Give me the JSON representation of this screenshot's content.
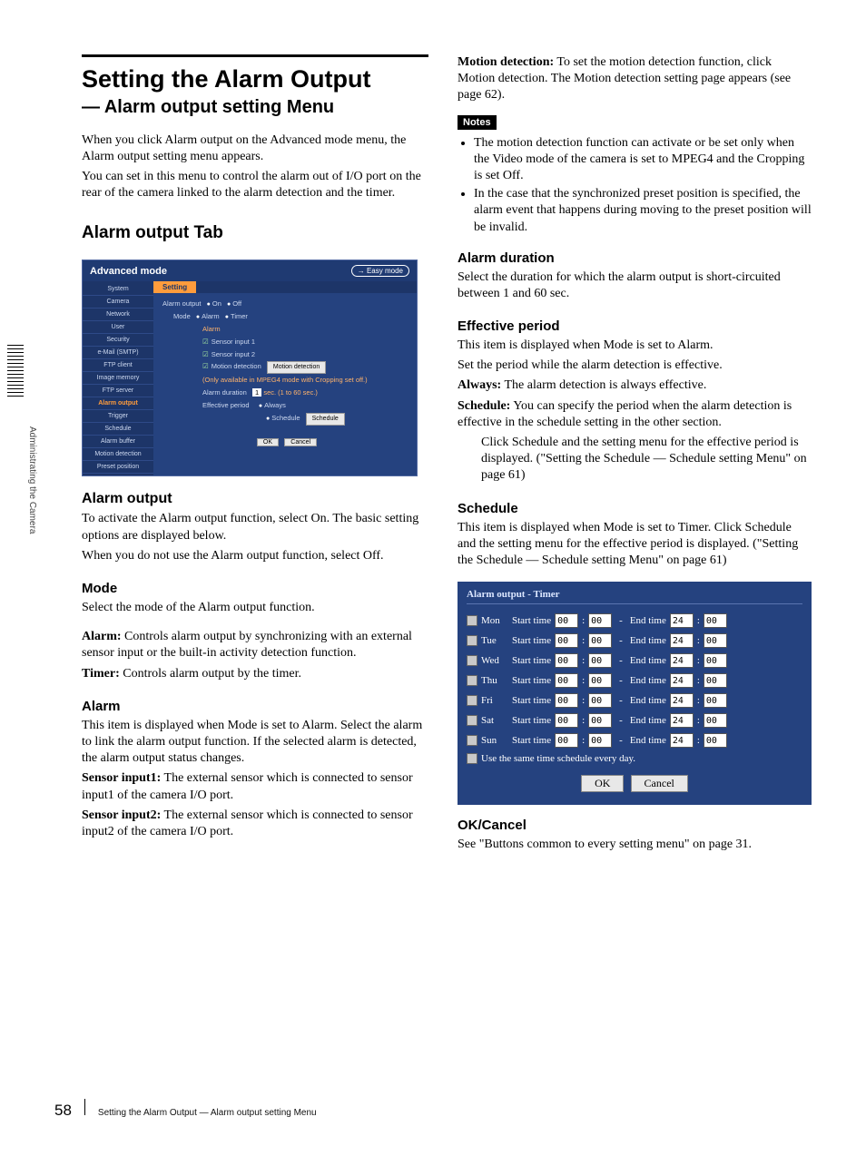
{
  "page": {
    "number": "58",
    "footer": "Setting the Alarm Output — Alarm output setting Menu",
    "side_label": "Administrating the Camera"
  },
  "heading": {
    "title": "Setting the Alarm Output",
    "subtitle": "— Alarm output setting Menu"
  },
  "intro": [
    "When you click Alarm output on the Advanced mode menu, the Alarm output setting menu appears.",
    "You can set in this menu to control the alarm out of I/O port on the rear of the camera linked to the alarm detection and the timer."
  ],
  "section_tab": "Alarm output Tab",
  "panel": {
    "mode_label": "Advanced mode",
    "easy_btn": "→ Easy mode",
    "tab": "Setting",
    "sidebar": [
      "System",
      "Camera",
      "Network",
      "User",
      "Security",
      "e-Mail (SMTP)",
      "FTP client",
      "Image memory",
      "FTP server",
      "Alarm output",
      "Trigger",
      "Schedule",
      "Alarm buffer",
      "Motion detection",
      "Preset position"
    ],
    "active_index": 9,
    "form": {
      "alarm_output_label": "Alarm output",
      "on": "On",
      "off": "Off",
      "mode_label": "Mode",
      "alarm_opt": "Alarm",
      "timer_opt": "Timer",
      "alarm_head": "Alarm",
      "sensor1": "Sensor input 1",
      "sensor2": "Sensor input 2",
      "motion": "Motion detection",
      "motion_btn": "Motion detection",
      "mpeg_note": "(Only available in MPEG4 mode with Cropping set off.)",
      "duration_label": "Alarm duration",
      "duration_val": "1",
      "duration_unit": "sec. (1 to 60 sec.)",
      "eff_label": "Effective period",
      "always": "Always",
      "schedule": "Schedule",
      "schedule_btn": "Schedule",
      "ok": "OK",
      "cancel": "Cancel"
    }
  },
  "alarm_output": {
    "h": "Alarm output",
    "p1": "To activate the Alarm output function, select On.  The basic setting options are displayed below.",
    "p2": "When you do not use the Alarm output function, select Off."
  },
  "mode": {
    "h": "Mode",
    "p": "Select the mode of the Alarm output function.",
    "alarm_t": "Alarm:",
    "alarm_d": " Controls alarm output by synchronizing with an external sensor input or the built-in activity detection function.",
    "timer_t": "Timer:",
    "timer_d": " Controls alarm output by the timer."
  },
  "alarm": {
    "h": "Alarm",
    "p": "This item is displayed when Mode is set to Alarm. Select the alarm to link the alarm output function.  If the selected alarm is detected, the alarm output status changes.",
    "s1_t": "Sensor input1:",
    "s1_d": " The external sensor which is connected to sensor input1 of the camera I/O port.",
    "s2_t": "Sensor input2:",
    "s2_d": " The external sensor which is connected to sensor input2 of the camera I/O port.",
    "md_t": "Motion detection:",
    "md_d": " To set the motion detection function, click Motion detection.   The Motion detection setting page appears (see page 62)."
  },
  "notes": {
    "label": "Notes",
    "items": [
      "The motion detection function can activate or be set only when the Video mode of the camera is set to MPEG4 and the Cropping is set Off.",
      "In the case that the synchronized preset position is specified, the alarm event that happens during moving to the preset position will be invalid."
    ]
  },
  "duration": {
    "h": "Alarm duration",
    "p": "Select the duration for which the alarm output is short-circuited between 1 and 60 sec."
  },
  "effective": {
    "h": "Effective period",
    "p1": "This item is displayed when Mode is set to Alarm.",
    "p2": "Set the period while the alarm detection is effective.",
    "always_t": "Always:",
    "always_d": " The alarm detection is always effective.",
    "sched_t": "Schedule:",
    "sched_d": " You can specify the period when the alarm detection is effective in the schedule setting in the other section.",
    "sched_d2": "Click Schedule and the setting menu for the effective period is displayed. (\"Setting the Schedule — Schedule setting Menu\" on page 61)"
  },
  "schedule": {
    "h": "Schedule",
    "p": "This item is displayed when Mode is set to Timer. Click Schedule and the setting menu for the effective period is displayed. (\"Setting the Schedule — Schedule setting Menu\" on page 61)"
  },
  "timer_panel": {
    "title": "Alarm output - Timer",
    "days": [
      "Mon",
      "Tue",
      "Wed",
      "Thu",
      "Fri",
      "Sat",
      "Sun"
    ],
    "start_label": "Start time",
    "end_label": "End time",
    "start_hh": "00",
    "start_mm": "00",
    "end_hh": "24",
    "end_mm": "00",
    "same": "Use the same time schedule every day.",
    "ok": "OK",
    "cancel": "Cancel"
  },
  "okcancel": {
    "h": "OK/Cancel",
    "p": "See \"Buttons common to every setting menu\" on page 31."
  }
}
